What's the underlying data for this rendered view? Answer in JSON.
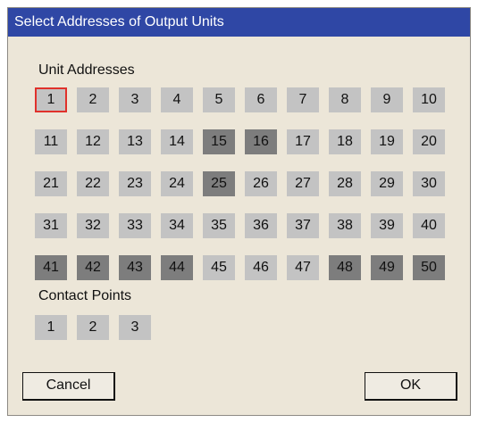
{
  "window": {
    "title": "Select Addresses of Output Units"
  },
  "unit_section": {
    "label": "Unit Addresses",
    "selected": "1",
    "dark_cells": [
      "15",
      "16",
      "25",
      "41",
      "42",
      "43",
      "44",
      "48",
      "49",
      "50"
    ],
    "rows": [
      [
        "1",
        "2",
        "3",
        "4",
        "5",
        "6",
        "7",
        "8",
        "9",
        "10"
      ],
      [
        "11",
        "12",
        "13",
        "14",
        "15",
        "16",
        "17",
        "18",
        "19",
        "20"
      ],
      [
        "21",
        "22",
        "23",
        "24",
        "25",
        "26",
        "27",
        "28",
        "29",
        "30"
      ],
      [
        "31",
        "32",
        "33",
        "34",
        "35",
        "36",
        "37",
        "38",
        "39",
        "40"
      ],
      [
        "41",
        "42",
        "43",
        "44",
        "45",
        "46",
        "47",
        "48",
        "49",
        "50"
      ]
    ]
  },
  "contact_section": {
    "label": "Contact Points",
    "items": [
      "1",
      "2",
      "3"
    ]
  },
  "buttons": {
    "cancel": "Cancel",
    "ok": "OK"
  },
  "colors": {
    "titlebar": "#2f47a5",
    "dialog_bg": "#ece6d8",
    "cell_light": "#c3c3c3",
    "cell_dark": "#7d7d7d",
    "selected_border": "#e0312b"
  }
}
